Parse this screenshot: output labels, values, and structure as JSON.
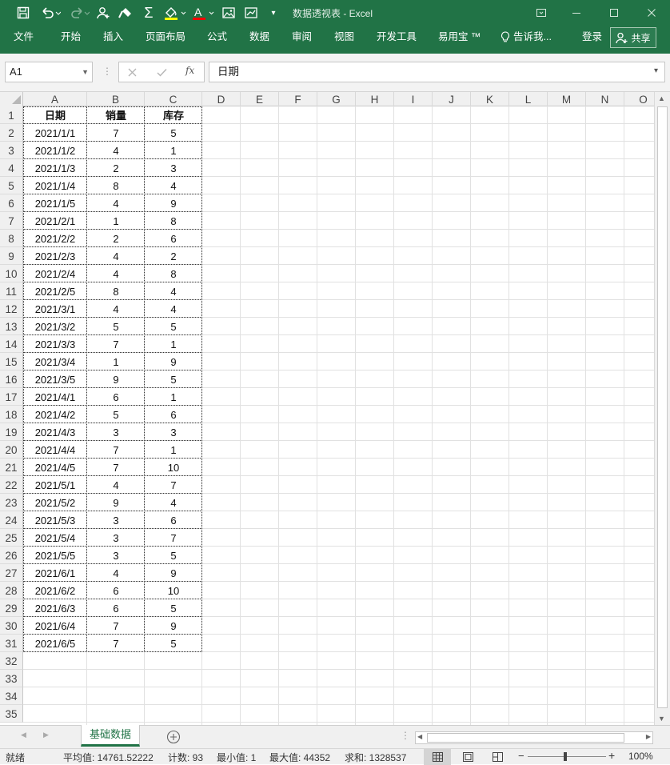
{
  "window": {
    "title": "数据透视表 - Excel",
    "accent_color": "#217346"
  },
  "quick_access": {
    "icons": [
      "save-icon",
      "undo-icon",
      "redo-icon",
      "add-person-icon",
      "format-painter-icon",
      "sum-icon",
      "fill-color-icon",
      "font-color-icon",
      "picture-icon",
      "chart-icon",
      "customize-icon"
    ]
  },
  "ribbon": {
    "tabs": [
      "文件",
      "开始",
      "插入",
      "页面布局",
      "公式",
      "数据",
      "审阅",
      "视图",
      "开发工具",
      "易用宝 ™"
    ],
    "tell_me": "告诉我...",
    "login": "登录",
    "share": "共享"
  },
  "formula_bar": {
    "name_box": "A1",
    "fx_label": "fx",
    "formula": "日期"
  },
  "grid": {
    "columns": [
      "A",
      "B",
      "C",
      "D",
      "E",
      "F",
      "G",
      "H",
      "I",
      "J",
      "K",
      "L",
      "M",
      "N",
      "O"
    ],
    "rows": [
      "1",
      "2",
      "3",
      "4",
      "5",
      "6",
      "7",
      "8",
      "9",
      "10",
      "11",
      "12",
      "13",
      "14",
      "15",
      "16",
      "17",
      "18",
      "19",
      "20",
      "21",
      "22",
      "23",
      "24",
      "25",
      "26",
      "27",
      "28",
      "29",
      "30",
      "31",
      "32",
      "33",
      "34",
      "35"
    ],
    "header": [
      "日期",
      "销量",
      "库存"
    ],
    "data": [
      [
        "2021/1/1",
        "7",
        "5"
      ],
      [
        "2021/1/2",
        "4",
        "1"
      ],
      [
        "2021/1/3",
        "2",
        "3"
      ],
      [
        "2021/1/4",
        "8",
        "4"
      ],
      [
        "2021/1/5",
        "4",
        "9"
      ],
      [
        "2021/2/1",
        "1",
        "8"
      ],
      [
        "2021/2/2",
        "2",
        "6"
      ],
      [
        "2021/2/3",
        "4",
        "2"
      ],
      [
        "2021/2/4",
        "4",
        "8"
      ],
      [
        "2021/2/5",
        "8",
        "4"
      ],
      [
        "2021/3/1",
        "4",
        "4"
      ],
      [
        "2021/3/2",
        "5",
        "5"
      ],
      [
        "2021/3/3",
        "7",
        "1"
      ],
      [
        "2021/3/4",
        "1",
        "9"
      ],
      [
        "2021/3/5",
        "9",
        "5"
      ],
      [
        "2021/4/1",
        "6",
        "1"
      ],
      [
        "2021/4/2",
        "5",
        "6"
      ],
      [
        "2021/4/3",
        "3",
        "3"
      ],
      [
        "2021/4/4",
        "7",
        "1"
      ],
      [
        "2021/4/5",
        "7",
        "10"
      ],
      [
        "2021/5/1",
        "4",
        "7"
      ],
      [
        "2021/5/2",
        "9",
        "4"
      ],
      [
        "2021/5/3",
        "3",
        "6"
      ],
      [
        "2021/5/4",
        "3",
        "7"
      ],
      [
        "2021/5/5",
        "3",
        "5"
      ],
      [
        "2021/6/1",
        "4",
        "9"
      ],
      [
        "2021/6/2",
        "6",
        "10"
      ],
      [
        "2021/6/3",
        "6",
        "5"
      ],
      [
        "2021/6/4",
        "7",
        "9"
      ],
      [
        "2021/6/5",
        "7",
        "5"
      ]
    ]
  },
  "sheets": {
    "active": "基础数据"
  },
  "status": {
    "mode": "就绪",
    "average": "平均值: 14761.52222",
    "count": "计数: 93",
    "min": "最小值: 1",
    "max": "最大值: 44352",
    "sum": "求和: 1328537",
    "zoom": "100%"
  }
}
